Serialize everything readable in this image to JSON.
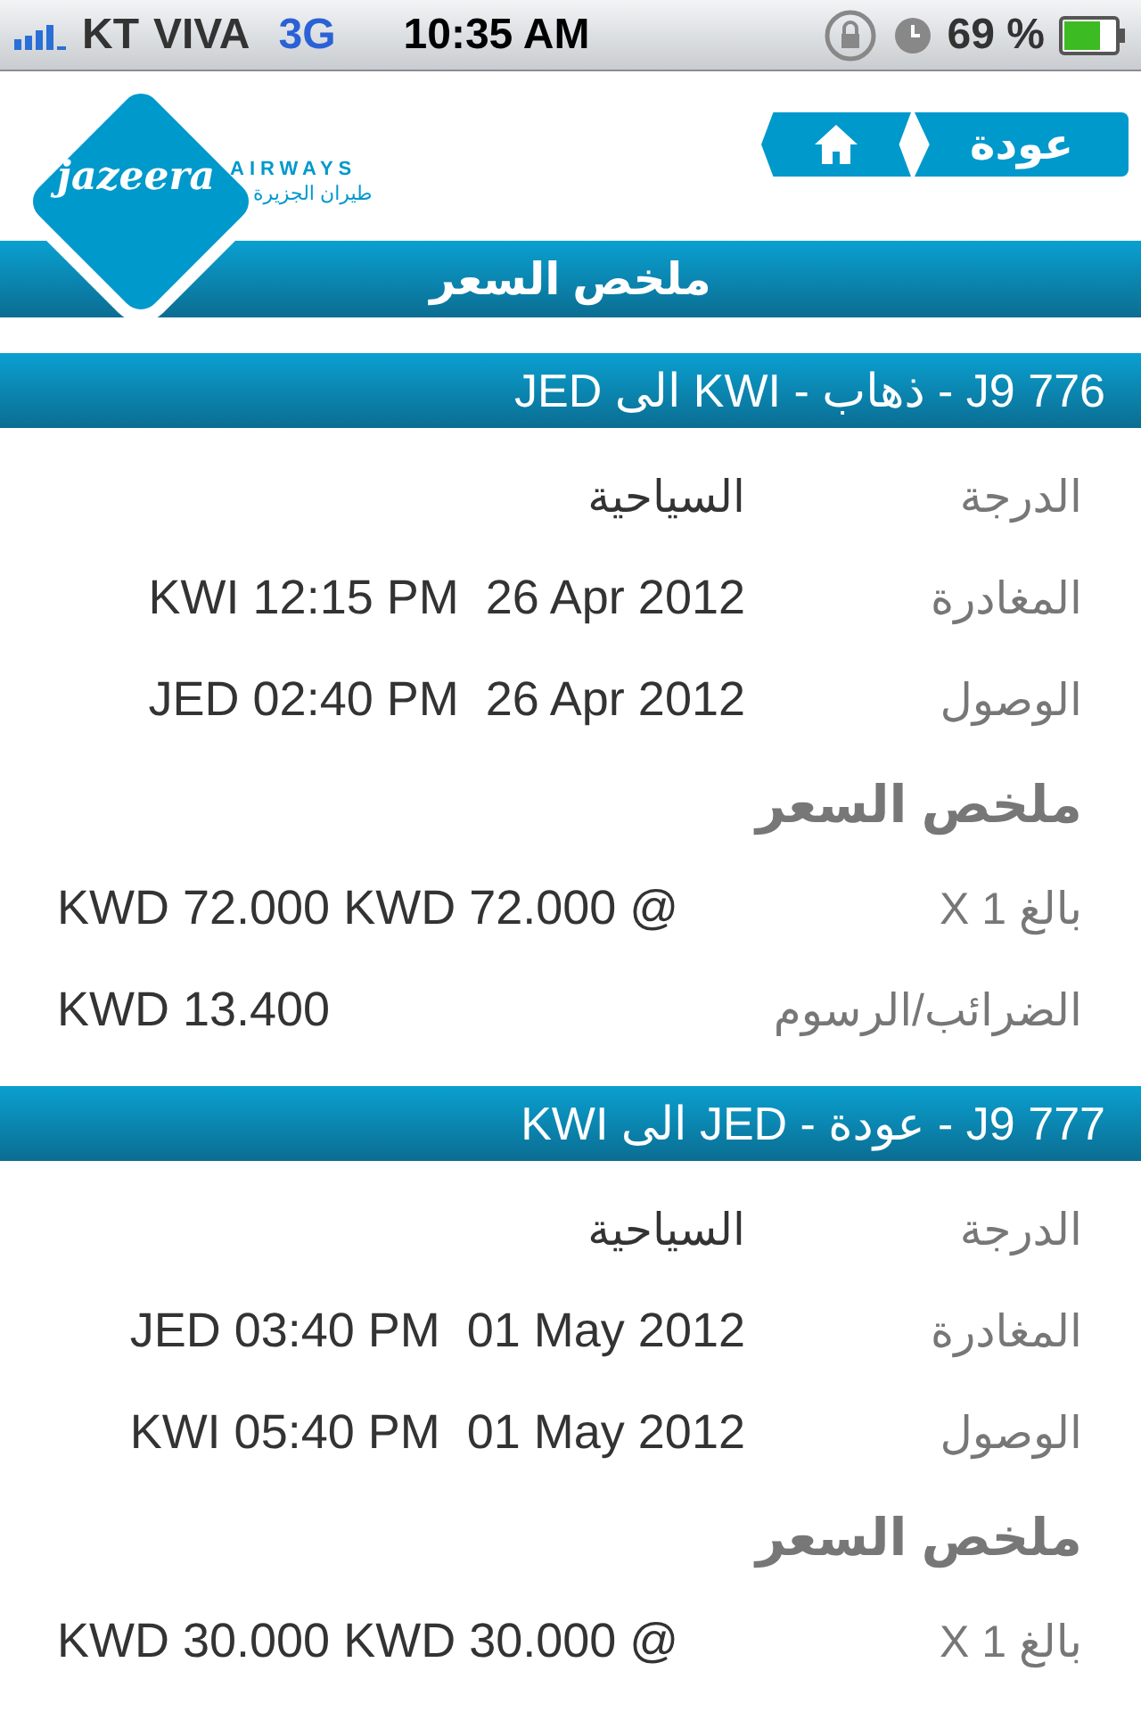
{
  "status_bar": {
    "carrier": "KT",
    "network": "VIVA",
    "data": "3G",
    "time": "10:35 AM",
    "battery": "69 %"
  },
  "header": {
    "logo": {
      "wordmark": "jazeera",
      "airways": "AIRWAYS",
      "arabic": "طيران الجزيرة"
    },
    "back_button": "عودة",
    "title": "ملخص السعر"
  },
  "flights": [
    {
      "heading": "J9 776 - ذهاب - KWI الى JED",
      "rows": [
        {
          "label": "الدرجة",
          "value": "السياحية",
          "kind": "arabic"
        },
        {
          "label": "المغادرة",
          "value": "KWI 12:15 PM  26 Apr 2012",
          "kind": "latin"
        },
        {
          "label": "الوصول",
          "value": "JED 02:40 PM  26 Apr 2012",
          "kind": "latin"
        }
      ],
      "fare_title": "ملخص السعر",
      "fare_rows": [
        {
          "label": "بالغ X 1",
          "value": "KWD 72.000 KWD 72.000 @"
        },
        {
          "label": "الضرائب/الرسوم",
          "value": "KWD 13.400"
        }
      ]
    },
    {
      "heading": "J9 777 - عودة - JED الى KWI",
      "rows": [
        {
          "label": "الدرجة",
          "value": "السياحية",
          "kind": "arabic"
        },
        {
          "label": "المغادرة",
          "value": "JED 03:40 PM  01 May 2012",
          "kind": "latin"
        },
        {
          "label": "الوصول",
          "value": "KWI 05:40 PM  01 May 2012",
          "kind": "latin"
        }
      ],
      "fare_title": "ملخص السعر",
      "fare_rows": [
        {
          "label": "بالغ X 1",
          "value": "KWD 30.000 KWD 30.000 @"
        }
      ]
    }
  ]
}
